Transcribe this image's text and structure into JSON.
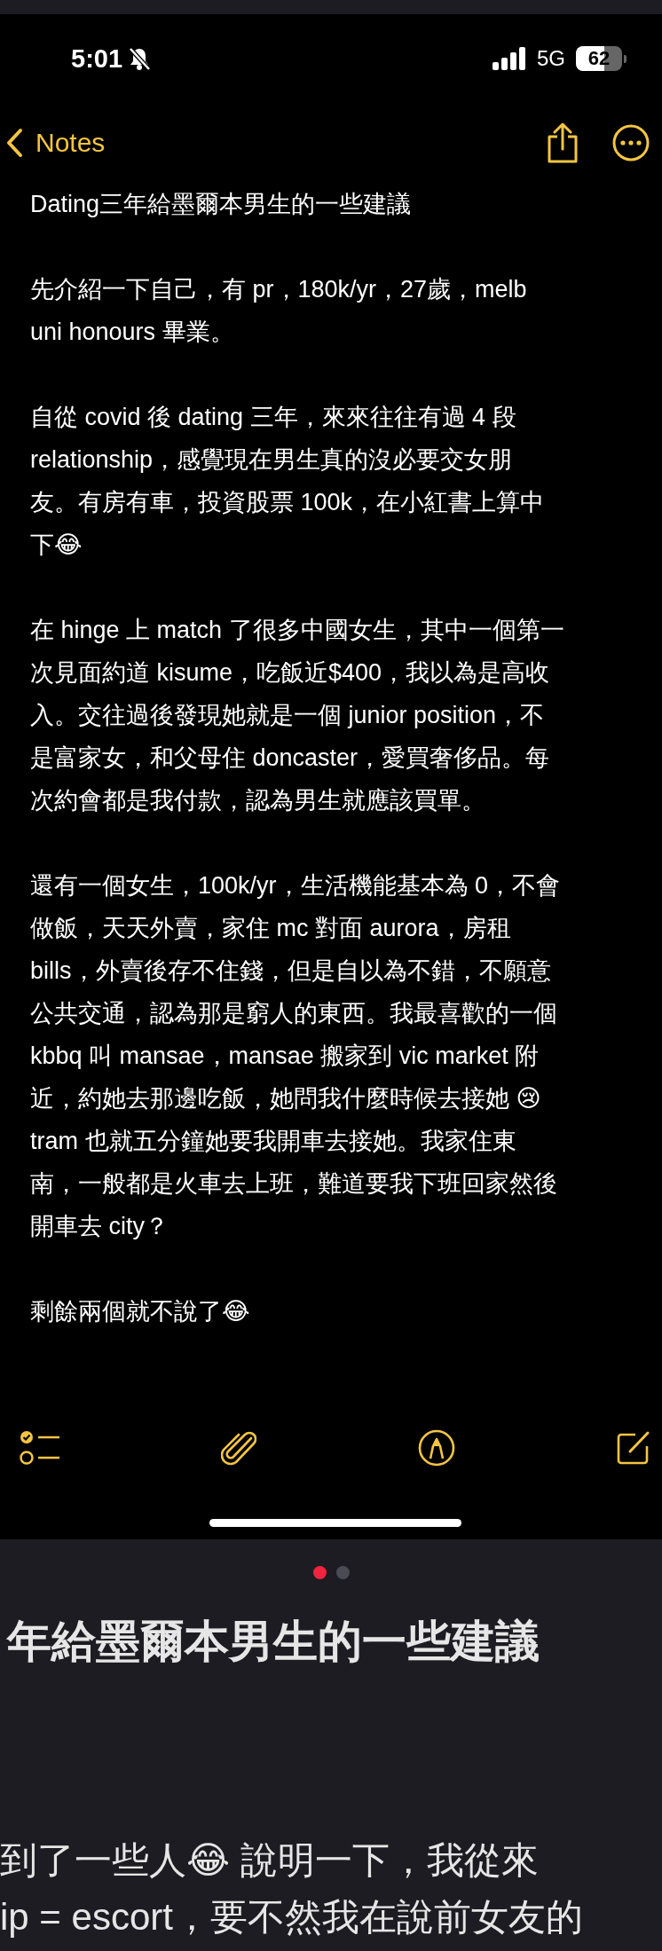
{
  "status_bar": {
    "time": "5:01",
    "network": "5G",
    "battery": "62"
  },
  "nav": {
    "back_label": "Notes"
  },
  "note": {
    "paragraphs": [
      [
        "Dating三年給墨爾本男生的一些建議"
      ],
      [
        "先介紹一下自己，有 pr，180k/yr，27歲，melb",
        "uni honours 畢業。"
      ],
      [
        "自從 covid 後 dating 三年，來來往往有過 4 段",
        "relationship，感覺現在男生真的沒必要交女朋",
        "友。有房有車，投資股票 100k，在小紅書上算中",
        "下😂"
      ],
      [
        "在 hinge 上 match 了很多中國女生，其中一個第一",
        "次見面約道 kisume，吃飯近$400，我以為是高收",
        "入。交往過後發現她就是一個 junior position，不",
        "是富家女，和父母住 doncaster，愛買奢侈品。每",
        "次約會都是我付款，認為男生就應該買單。"
      ],
      [
        "還有一個女生，100k/yr，生活機能基本為 0，不會",
        "做飯，天天外賣，家住 mc 對面 aurora，房租",
        "bills，外賣後存不住錢，但是自以為不錯，不願意",
        "公共交通，認為那是窮人的東西。我最喜歡的一個",
        "kbbq 叫 mansae，mansae 搬家到 vic market 附",
        "近，約她去那邊吃飯，她問我什麼時候去接她 😢",
        "tram 也就五分鐘她要我開車去接她。我家住東",
        "南，一般都是火車去上班，難道要我下班回家然後",
        "開車去 city？"
      ],
      [
        "剩餘兩個就不說了😂"
      ]
    ]
  },
  "post": {
    "page_dots": [
      {
        "selected": true
      },
      {
        "selected": false
      }
    ],
    "heading": "年給墨爾本男生的一些建議",
    "lines": [
      "到了一些人😂 說明一下，我從來",
      "ip = escort，要不然我在說前女友的"
    ]
  }
}
